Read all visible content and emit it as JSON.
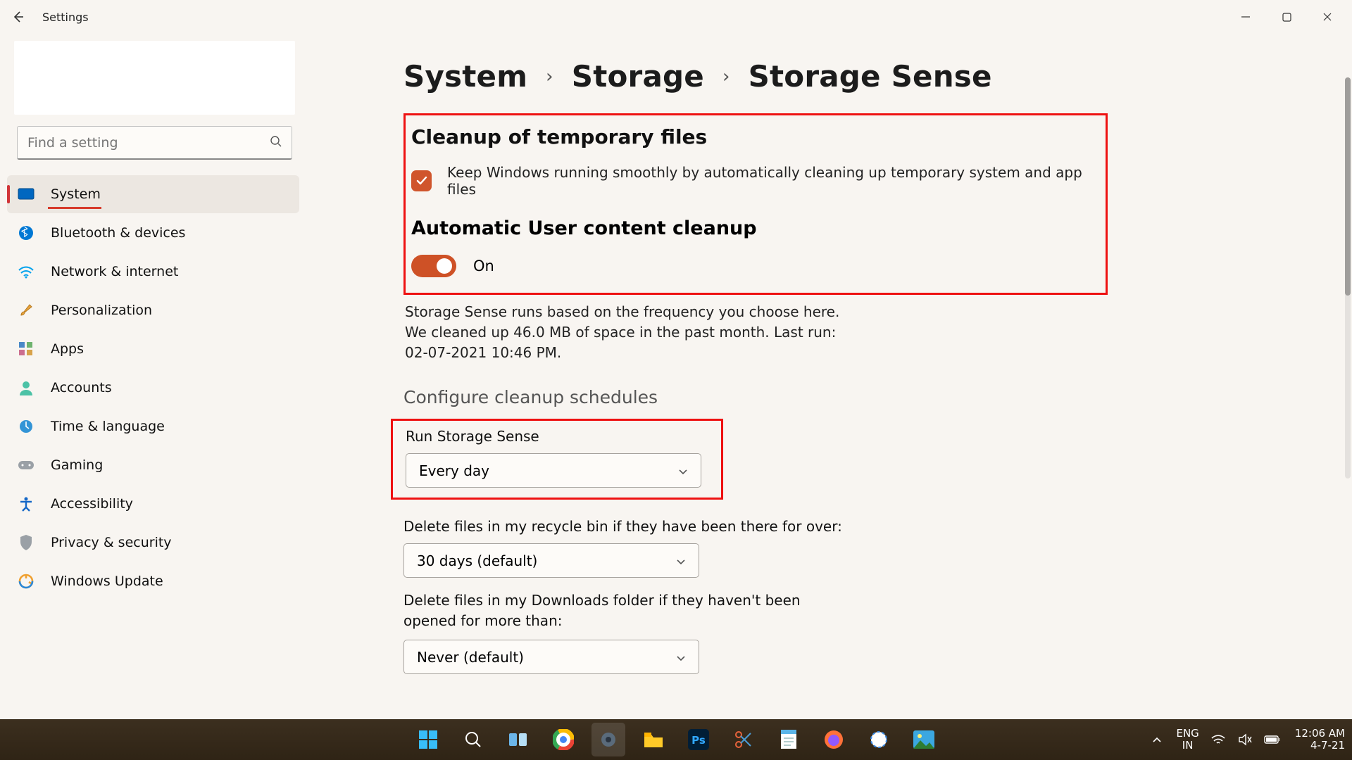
{
  "window": {
    "title": "Settings"
  },
  "search": {
    "placeholder": "Find a setting"
  },
  "sidebar": {
    "items": [
      {
        "label": "System"
      },
      {
        "label": "Bluetooth & devices"
      },
      {
        "label": "Network & internet"
      },
      {
        "label": "Personalization"
      },
      {
        "label": "Apps"
      },
      {
        "label": "Accounts"
      },
      {
        "label": "Time & language"
      },
      {
        "label": "Gaming"
      },
      {
        "label": "Accessibility"
      },
      {
        "label": "Privacy & security"
      },
      {
        "label": "Windows Update"
      }
    ]
  },
  "breadcrumb": {
    "l1": "System",
    "l2": "Storage",
    "l3": "Storage Sense"
  },
  "section": {
    "cleanup_title": "Cleanup of temporary files",
    "cleanup_check": "Keep Windows running smoothly by automatically cleaning up temporary system and app files",
    "auto_title": "Automatic User content cleanup",
    "toggle_state": "On",
    "desc": "Storage Sense runs based on the frequency you choose here. We cleaned up 46.0 MB of space in the past month. Last run: 02-07-2021 10:46 PM.",
    "schedules_title": "Configure cleanup schedules",
    "run_label": "Run Storage Sense",
    "run_value": "Every day",
    "recycle_label": "Delete files in my recycle bin if they have been there for over:",
    "recycle_value": "30 days (default)",
    "downloads_label": "Delete files in my Downloads folder if they haven't been opened for more than:",
    "downloads_value": "Never (default)"
  },
  "tray": {
    "lang1": "ENG",
    "lang2": "IN",
    "time": "12:06 AM",
    "date": "4-7-21"
  }
}
